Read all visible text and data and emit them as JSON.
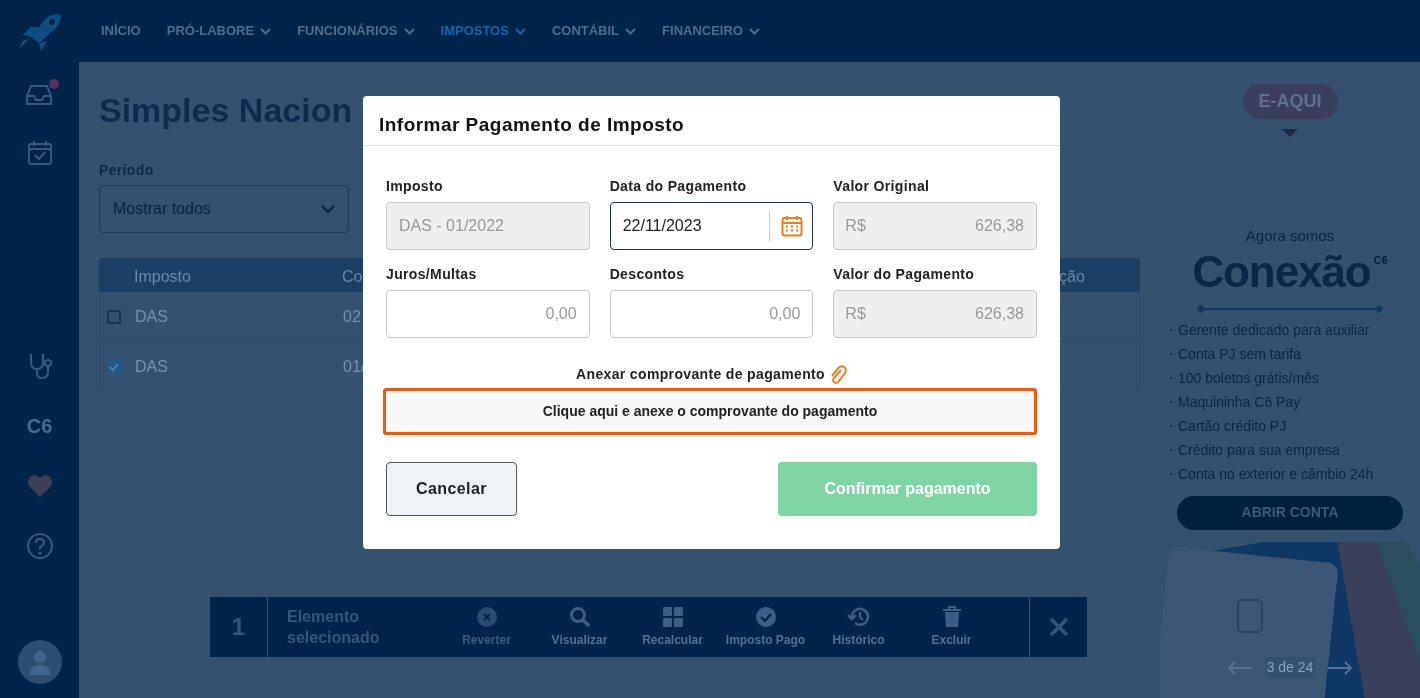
{
  "nav": {
    "items": [
      {
        "label": "INÍCIO",
        "dropdown": false,
        "selected": false
      },
      {
        "label": "PRÓ-LABORE",
        "dropdown": true,
        "selected": false
      },
      {
        "label": "FUNCIONÁRIOS",
        "dropdown": true,
        "selected": false
      },
      {
        "label": "IMPOSTOS",
        "dropdown": true,
        "selected": true
      },
      {
        "label": "CONTÁBIL",
        "dropdown": true,
        "selected": false
      },
      {
        "label": "FINANCEIRO",
        "dropdown": true,
        "selected": false
      }
    ]
  },
  "sidebar": {
    "items": [
      {
        "kind": "inbox",
        "badge": true
      },
      {
        "kind": "calendar",
        "badge": false
      },
      {
        "kind": "stethoscope",
        "badge": false
      },
      {
        "kind": "text",
        "label": "C6",
        "badge": false
      },
      {
        "kind": "heart",
        "badge": false
      },
      {
        "kind": "help",
        "badge": false
      }
    ]
  },
  "page": {
    "title": "Simples Nacion",
    "period": {
      "label": "Período",
      "value": "Mostrar todos"
    },
    "table": {
      "columns": [
        "Imposto",
        "Co",
        "ção"
      ],
      "rows": [
        {
          "checked": false,
          "cells": [
            "DAS",
            "02"
          ]
        },
        {
          "checked": true,
          "cells": [
            "DAS",
            "01/"
          ]
        }
      ]
    }
  },
  "action_bar": {
    "count": "1",
    "label": "Elemento selecionado",
    "actions": [
      {
        "label": "Reverter",
        "kind": "revert",
        "disabled": true
      },
      {
        "label": "Visualizar",
        "kind": "search",
        "disabled": false
      },
      {
        "label": "Recalcular",
        "kind": "calculator",
        "disabled": false
      },
      {
        "label": "Imposto Pago",
        "kind": "check",
        "disabled": false
      },
      {
        "label": "Histórico",
        "kind": "history",
        "disabled": false
      },
      {
        "label": "Excluir",
        "kind": "trash",
        "disabled": false
      }
    ]
  },
  "promo": {
    "badge": "E-AQUI",
    "intro": "Agora somos",
    "brand": "Conexão",
    "brand_mark": "C6",
    "features": [
      {
        "text": "Gerente dedicado para auxiliar"
      },
      {
        "text": "Conta PJ sem tarifa"
      },
      {
        "text": "100 boletos grátis/mês"
      },
      {
        "text": "Maquininha C6 Pay"
      },
      {
        "text": "Cartão crédito PJ"
      },
      {
        "text": "Crédito para sua empresa"
      },
      {
        "text": "Conta no exterior e câmbio 24h"
      }
    ],
    "button": "ABRIR CONTA",
    "pager": "3 de 24"
  },
  "modal": {
    "title": "Informar Pagamento de Imposto",
    "fields": [
      {
        "label": "Imposto",
        "kind": "text",
        "value": "DAS - 01/2022",
        "disabled": true,
        "focused": false
      },
      {
        "label": "Data do Pagamento",
        "kind": "date",
        "value": "22/11/2023",
        "disabled": false,
        "focused": true
      },
      {
        "label": "Valor Original",
        "kind": "money",
        "prefix": "R$",
        "value": "626,38",
        "disabled": true,
        "focused": false
      },
      {
        "label": "Juros/Multas",
        "kind": "money",
        "placeholder": "0,00",
        "disabled": false,
        "focused": false
      },
      {
        "label": "Descontos",
        "kind": "money",
        "placeholder": "0,00",
        "disabled": false,
        "focused": false
      },
      {
        "label": "Valor do Pagamento",
        "kind": "money",
        "prefix": "R$",
        "value": "626,38",
        "disabled": true,
        "focused": false
      }
    ],
    "attach_label": "Anexar comprovante de pagamento",
    "attach_button": "Clique aqui e anexe o comprovante do pagamento",
    "cancel": "Cancelar",
    "confirm": {
      "label": "Confirmar pagamento",
      "disabled": true
    }
  }
}
